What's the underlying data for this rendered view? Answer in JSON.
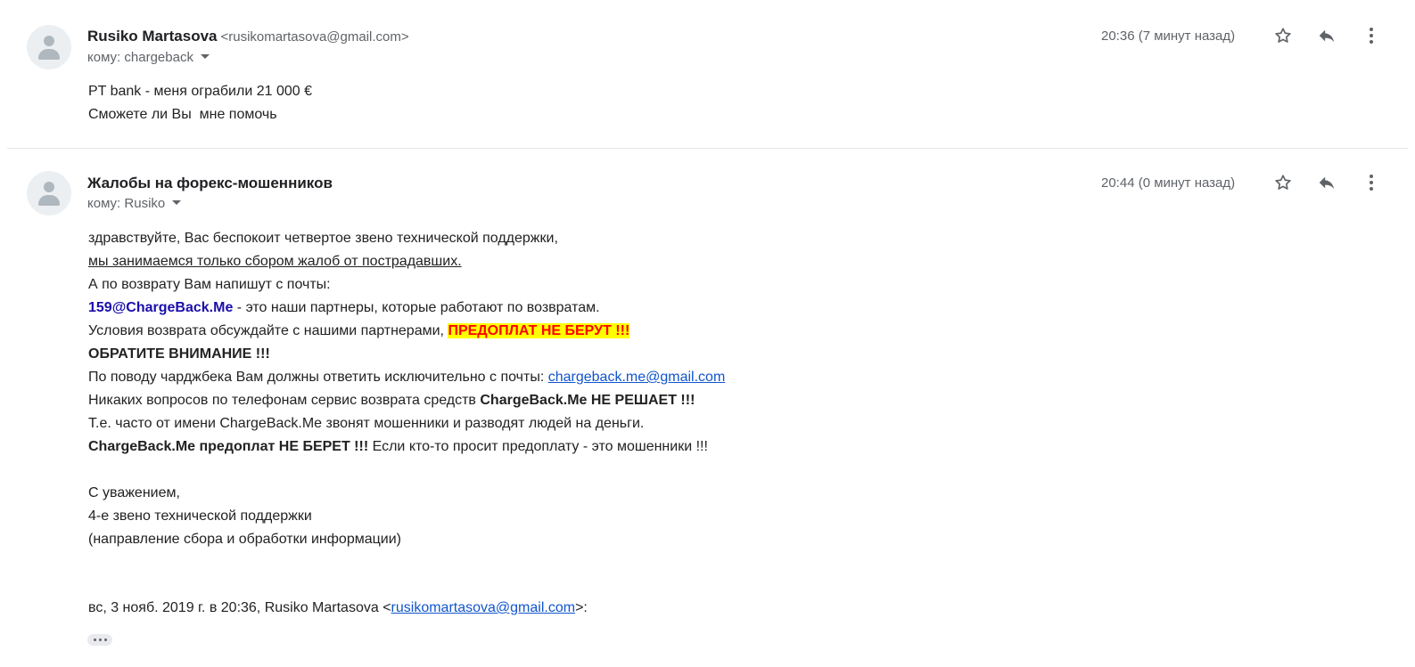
{
  "messages": [
    {
      "sender_name": "Rusiko Martasova",
      "sender_email": "<rusikomartasova@gmail.com>",
      "to_label": "кому: chargeback",
      "time": "20:36 (7 минут назад)",
      "body": [
        "PT bank - меня ограбили 21 000 €",
        "Сможете ли Вы  мне помочь"
      ]
    },
    {
      "sender_name": "Жалобы на форекс-мошенников",
      "to_label": "кому: Rusiko",
      "time": "20:44 (0 минут назад)",
      "body": {
        "line1": "здравствуйте, Вас беспокоит четвертое звено технической поддержки,",
        "line2": "мы занимаемся только сбором жалоб от пострадавших.",
        "line3": "А по возврату Вам напишут с почты:",
        "line4_email": "159@ChargeBack.Me",
        "line4_rest": " - это наши партнеры, которые работают по возвратам.",
        "line5_text": "Условия возврата обсуждайте с нашими партнерами, ",
        "line5_highlight": "ПРЕДОПЛАТ НЕ БЕРУТ !!!",
        "line6": "ОБРАТИТЕ ВНИМАНИЕ !!!",
        "line7_text": "По поводу чарджбека Вам должны ответить исключительно с почты: ",
        "line7_link": "chargeback.me@gmail.com",
        "line8_text": "Никаких вопросов по телефонам сервис возврата средств ",
        "line8_bold": "ChargeBack.Me НЕ РЕШАЕТ !!!",
        "line9": "Т.е. часто от имени ChargeBack.Me звонят мошенники и разводят людей на деньги.",
        "line10_bold": "ChargeBack.Me предоплат НЕ БЕРЕТ !!!",
        "line10_rest": " Если кто-то просит предоплату - это мошенники !!!",
        "sig1": "С уважением,",
        "sig2": "4-е звено технической поддержки",
        "sig3": "(направление сбора и обработки информации)"
      },
      "quote_prefix": "вс, 3 нояб. 2019 г. в 20:36, Rusiko Martasova <",
      "quote_link": "rusikomartasova@gmail.com",
      "quote_suffix": ">:"
    }
  ],
  "icons": [
    "star-icon",
    "reply-icon",
    "more-vert-icon",
    "avatar-icon",
    "ellipsis-icon"
  ],
  "colors": {
    "link": "#1155cc",
    "highlight_bg": "#ffff00",
    "highlight_text": "#ff0000",
    "muted": "#5f6368"
  }
}
